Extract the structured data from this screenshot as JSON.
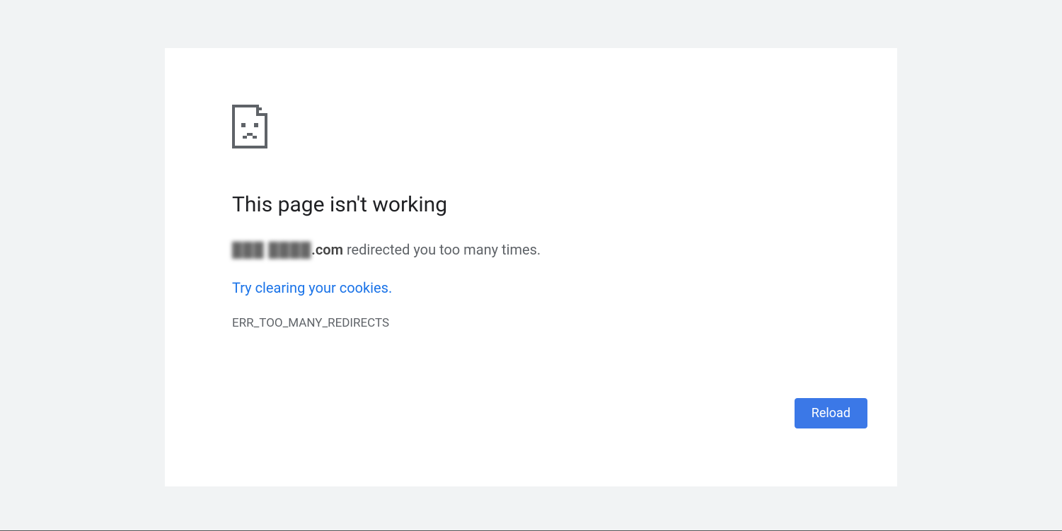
{
  "error": {
    "title": "This page isn't working",
    "domain_obscured": "███ ████",
    "domain_suffix": ".com",
    "message_suffix": " redirected you too many times.",
    "cookies_link_text": "Try clearing your cookies",
    "cookies_period": ".",
    "error_code": "ERR_TOO_MANY_REDIRECTS",
    "reload_label": "Reload"
  }
}
